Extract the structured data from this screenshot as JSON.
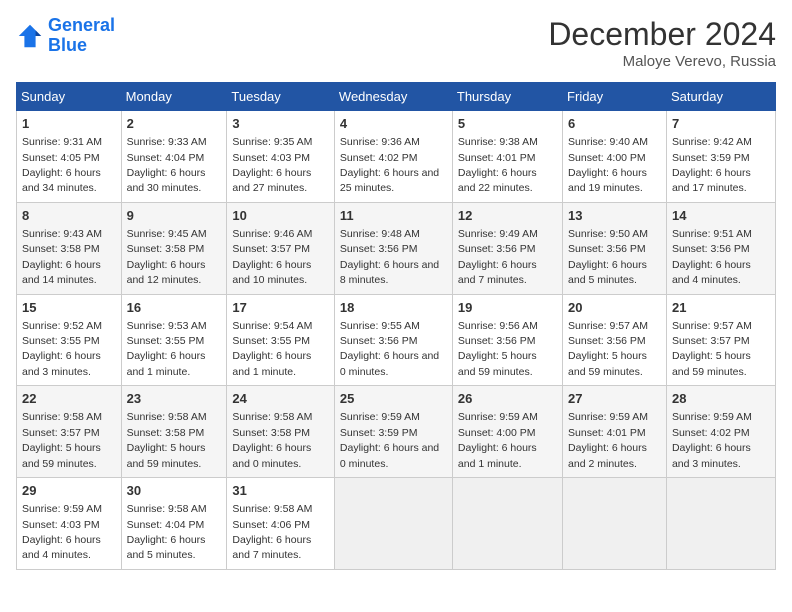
{
  "header": {
    "logo_line1": "General",
    "logo_line2": "Blue",
    "month": "December 2024",
    "location": "Maloye Verevo, Russia"
  },
  "days_of_week": [
    "Sunday",
    "Monday",
    "Tuesday",
    "Wednesday",
    "Thursday",
    "Friday",
    "Saturday"
  ],
  "weeks": [
    [
      {
        "day": "1",
        "rise": "9:31 AM",
        "set": "4:05 PM",
        "daylight": "6 hours and 34 minutes."
      },
      {
        "day": "2",
        "rise": "9:33 AM",
        "set": "4:04 PM",
        "daylight": "6 hours and 30 minutes."
      },
      {
        "day": "3",
        "rise": "9:35 AM",
        "set": "4:03 PM",
        "daylight": "6 hours and 27 minutes."
      },
      {
        "day": "4",
        "rise": "9:36 AM",
        "set": "4:02 PM",
        "daylight": "6 hours and 25 minutes."
      },
      {
        "day": "5",
        "rise": "9:38 AM",
        "set": "4:01 PM",
        "daylight": "6 hours and 22 minutes."
      },
      {
        "day": "6",
        "rise": "9:40 AM",
        "set": "4:00 PM",
        "daylight": "6 hours and 19 minutes."
      },
      {
        "day": "7",
        "rise": "9:42 AM",
        "set": "3:59 PM",
        "daylight": "6 hours and 17 minutes."
      }
    ],
    [
      {
        "day": "8",
        "rise": "9:43 AM",
        "set": "3:58 PM",
        "daylight": "6 hours and 14 minutes."
      },
      {
        "day": "9",
        "rise": "9:45 AM",
        "set": "3:58 PM",
        "daylight": "6 hours and 12 minutes."
      },
      {
        "day": "10",
        "rise": "9:46 AM",
        "set": "3:57 PM",
        "daylight": "6 hours and 10 minutes."
      },
      {
        "day": "11",
        "rise": "9:48 AM",
        "set": "3:56 PM",
        "daylight": "6 hours and 8 minutes."
      },
      {
        "day": "12",
        "rise": "9:49 AM",
        "set": "3:56 PM",
        "daylight": "6 hours and 7 minutes."
      },
      {
        "day": "13",
        "rise": "9:50 AM",
        "set": "3:56 PM",
        "daylight": "6 hours and 5 minutes."
      },
      {
        "day": "14",
        "rise": "9:51 AM",
        "set": "3:56 PM",
        "daylight": "6 hours and 4 minutes."
      }
    ],
    [
      {
        "day": "15",
        "rise": "9:52 AM",
        "set": "3:55 PM",
        "daylight": "6 hours and 3 minutes."
      },
      {
        "day": "16",
        "rise": "9:53 AM",
        "set": "3:55 PM",
        "daylight": "6 hours and 1 minute."
      },
      {
        "day": "17",
        "rise": "9:54 AM",
        "set": "3:55 PM",
        "daylight": "6 hours and 1 minute."
      },
      {
        "day": "18",
        "rise": "9:55 AM",
        "set": "3:56 PM",
        "daylight": "6 hours and 0 minutes."
      },
      {
        "day": "19",
        "rise": "9:56 AM",
        "set": "3:56 PM",
        "daylight": "5 hours and 59 minutes."
      },
      {
        "day": "20",
        "rise": "9:57 AM",
        "set": "3:56 PM",
        "daylight": "5 hours and 59 minutes."
      },
      {
        "day": "21",
        "rise": "9:57 AM",
        "set": "3:57 PM",
        "daylight": "5 hours and 59 minutes."
      }
    ],
    [
      {
        "day": "22",
        "rise": "9:58 AM",
        "set": "3:57 PM",
        "daylight": "5 hours and 59 minutes."
      },
      {
        "day": "23",
        "rise": "9:58 AM",
        "set": "3:58 PM",
        "daylight": "5 hours and 59 minutes."
      },
      {
        "day": "24",
        "rise": "9:58 AM",
        "set": "3:58 PM",
        "daylight": "6 hours and 0 minutes."
      },
      {
        "day": "25",
        "rise": "9:59 AM",
        "set": "3:59 PM",
        "daylight": "6 hours and 0 minutes."
      },
      {
        "day": "26",
        "rise": "9:59 AM",
        "set": "4:00 PM",
        "daylight": "6 hours and 1 minute."
      },
      {
        "day": "27",
        "rise": "9:59 AM",
        "set": "4:01 PM",
        "daylight": "6 hours and 2 minutes."
      },
      {
        "day": "28",
        "rise": "9:59 AM",
        "set": "4:02 PM",
        "daylight": "6 hours and 3 minutes."
      }
    ],
    [
      {
        "day": "29",
        "rise": "9:59 AM",
        "set": "4:03 PM",
        "daylight": "6 hours and 4 minutes."
      },
      {
        "day": "30",
        "rise": "9:58 AM",
        "set": "4:04 PM",
        "daylight": "6 hours and 5 minutes."
      },
      {
        "day": "31",
        "rise": "9:58 AM",
        "set": "4:06 PM",
        "daylight": "6 hours and 7 minutes."
      },
      null,
      null,
      null,
      null
    ]
  ]
}
